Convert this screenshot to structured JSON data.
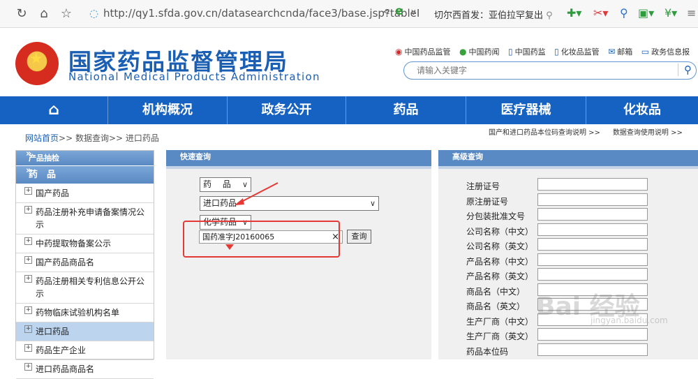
{
  "browser": {
    "url": "http://qy1.sfda.gov.cn/datasearchcnda/face3/base.jsp?tableI",
    "news_ticker": "切尔西首发：亚伯拉罕复出"
  },
  "header": {
    "title": "国家药品监督管理局",
    "subtitle": "National Medical Products Administration",
    "links": [
      "中国药品监管",
      "中国药闻",
      "中国药监",
      "化妆品监管",
      "邮箱",
      "政务信息报"
    ],
    "search_placeholder": "请输入关键字"
  },
  "mainnav": [
    "机构概况",
    "政务公开",
    "药品",
    "医疗器械",
    "化妆品"
  ],
  "breadcrumb": {
    "home": "网站首页",
    "rest": ">> 数据查询>> 进口药品"
  },
  "toplinks": [
    "国产和进口药品本位码查询说明 >>",
    "数据查询使用说明 >>"
  ],
  "sidebar": {
    "head1": "产品抽检",
    "head2": "药　品",
    "items": [
      "国产药品",
      "药品注册补充申请备案情况公示",
      "中药提取物备案公示",
      "国产药品商品名",
      "药品注册相关专利信息公开公示",
      "药物临床试验机构名单",
      "进口药品",
      "药品生产企业",
      "进口药品商品名"
    ],
    "active_index": 6
  },
  "quick": {
    "title": "快速查询",
    "category": "药　 品",
    "table": "进口药品",
    "subtype": "化学药品",
    "query_value": "国药准字J20160065",
    "query_button": "查询"
  },
  "advanced": {
    "title": "高级查询",
    "fields": [
      "注册证号",
      "原注册证号",
      "分包装批准文号",
      "公司名称（中文）",
      "公司名称（英文）",
      "产品名称（中文）",
      "产品名称（英文）",
      "商品名（中文）",
      "商品名（英文）",
      "生产厂商（中文）",
      "生产厂商（英文）",
      "药品本位码"
    ]
  },
  "watermark": {
    "main": "Bai 经验",
    "sub": "jingyan.baidu.com"
  },
  "colors": {
    "nav": "#1662c2",
    "brand": "#1a5fb4",
    "panel_head": "#5a8ac4",
    "highlight": "#e53935"
  }
}
